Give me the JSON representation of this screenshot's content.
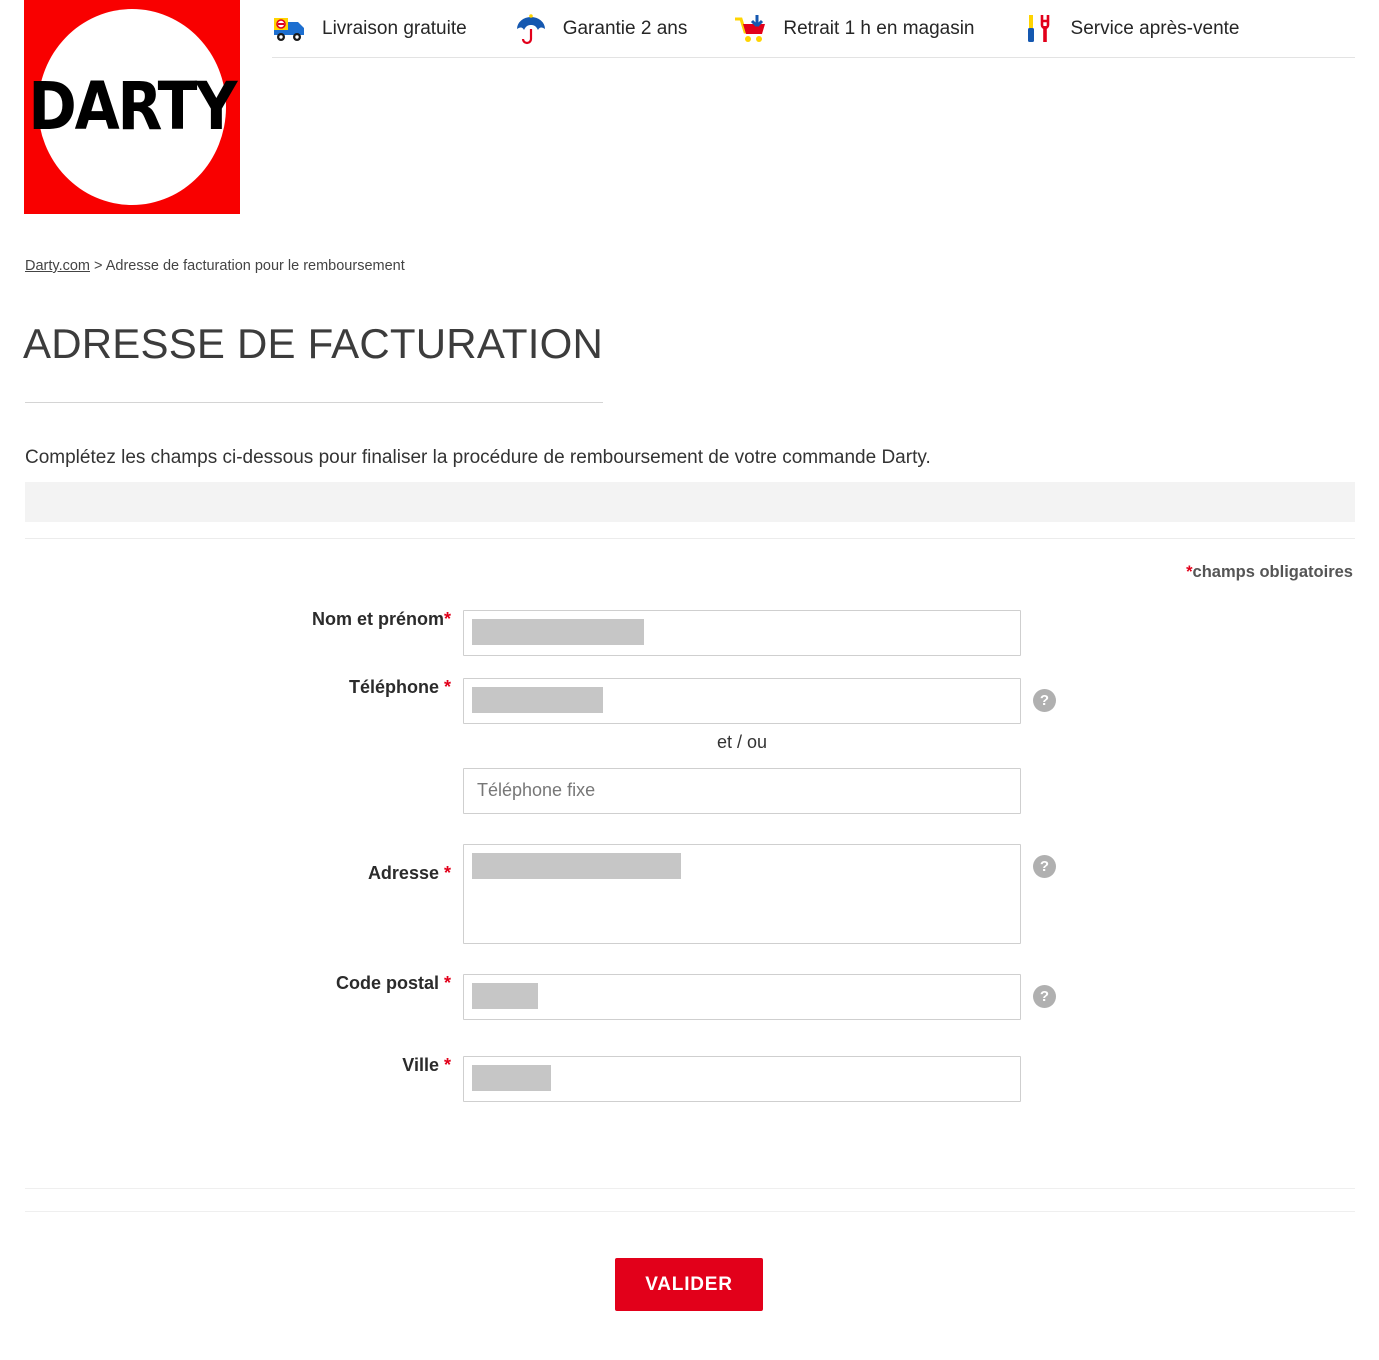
{
  "brand": {
    "logo_text": "DARTY",
    "logo_bg_color": "#f90000"
  },
  "promo_bar": {
    "items": [
      {
        "icon": "delivery-truck-icon",
        "label": "Livraison gratuite"
      },
      {
        "icon": "umbrella-icon",
        "label": "Garantie 2 ans"
      },
      {
        "icon": "shopping-cart-icon",
        "label": "Retrait 1 h en magasin"
      },
      {
        "icon": "tools-icon",
        "label": "Service après-vente"
      }
    ]
  },
  "breadcrumb": {
    "home_label": "Darty.com",
    "separator": " > ",
    "current_label": "Adresse de facturation pour le remboursement"
  },
  "page": {
    "title": "ADRESSE DE FACTURATION",
    "intro": "Complétez les champs ci-dessous pour finaliser la procédure de remboursement de votre commande Darty.",
    "required_note_star": "*",
    "required_note_text": "champs obligatoires",
    "accent_color": "#e2001a",
    "banner_color": "#f3f3f3"
  },
  "form": {
    "fields": [
      {
        "name": "nom-et-prenom",
        "label": "Nom et prénom",
        "required_mark": "*",
        "value_redacted": true,
        "redaction_width": 172,
        "help_icon": false,
        "type": "text",
        "placeholder": ""
      },
      {
        "name": "telephone",
        "label": "Téléphone ",
        "required_mark": "*",
        "value_redacted": true,
        "redaction_width": 131,
        "help_icon": true,
        "type": "text",
        "placeholder": ""
      },
      {
        "name": "telephone-fixe",
        "label": "",
        "required_mark": "",
        "value_redacted": false,
        "redaction_width": 0,
        "help_icon": false,
        "type": "text",
        "placeholder": "Téléphone fixe"
      },
      {
        "name": "adresse",
        "label": "Adresse ",
        "required_mark": "*",
        "value_redacted": true,
        "redaction_width": 209,
        "help_icon": true,
        "type": "textarea",
        "placeholder": ""
      },
      {
        "name": "code-postal",
        "label": "Code postal ",
        "required_mark": "*",
        "value_redacted": true,
        "redaction_width": 66,
        "help_icon": true,
        "type": "text",
        "placeholder": ""
      },
      {
        "name": "ville",
        "label": "Ville ",
        "required_mark": "*",
        "value_redacted": true,
        "redaction_width": 79,
        "help_icon": false,
        "type": "text",
        "placeholder": ""
      }
    ],
    "separator_label": "et / ou",
    "help_icon_glyph": "?",
    "submit_label": "VALIDER"
  }
}
